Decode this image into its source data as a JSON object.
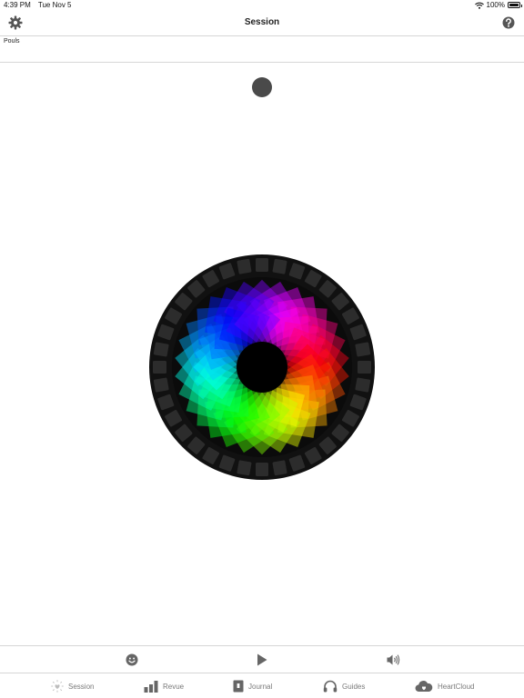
{
  "status_bar": {
    "time": "4:39 PM",
    "date": "Tue Nov 5",
    "battery": "100%",
    "battery_level": 1.0
  },
  "nav": {
    "title": "Session"
  },
  "panel": {
    "pulse_label": "Pouls"
  },
  "controls": {
    "mood_icon": "smiley-icon",
    "play_icon": "play-icon",
    "volume_icon": "speaker-icon"
  },
  "tabs": [
    {
      "label": "Session",
      "icon": "heart-sun-icon"
    },
    {
      "label": "Revue",
      "icon": "bar-chart-icon"
    },
    {
      "label": "Journal",
      "icon": "journal-icon"
    },
    {
      "label": "Guides",
      "icon": "headphones-icon"
    },
    {
      "label": "HeartCloud",
      "icon": "cloud-heart-icon"
    }
  ],
  "colors": {
    "indicator": "#4a4a4a",
    "ring": "#111111",
    "segment": "#2c2c2c"
  }
}
